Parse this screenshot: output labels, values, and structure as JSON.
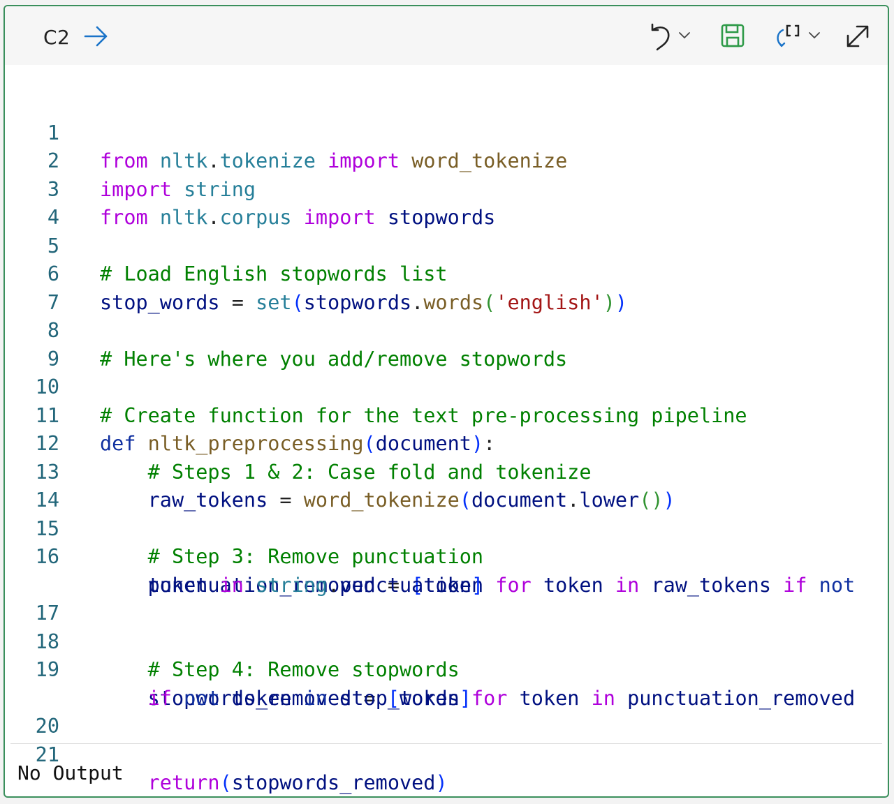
{
  "cell": {
    "id": "C2",
    "output_text": "No Output"
  },
  "toolbar": {
    "icons": [
      "run-arrow-icon",
      "undo-icon",
      "chevron-down-icon",
      "save-icon",
      "format-brackets-icon",
      "chevron-down-icon",
      "expand-icon"
    ]
  },
  "colors": {
    "border": "#3a8f5c",
    "keyword": "#af00db",
    "comment": "#008000",
    "string": "#a31515",
    "function": "#795e26",
    "module": "#267f99",
    "variable": "#001080",
    "line_number": "#22667a"
  },
  "code": {
    "line_numbers": [
      "1",
      "2",
      "3",
      "4",
      "5",
      "6",
      "7",
      "8",
      "9",
      "10",
      "11",
      "12",
      "13",
      "14",
      "15",
      "16",
      "17",
      "18",
      "19",
      "20",
      "21"
    ],
    "l1": {
      "a": "from",
      "b": "nltk",
      "c": ".",
      "d": "tokenize",
      "e": "import",
      "f": "word_tokenize"
    },
    "l2": {
      "a": "import",
      "b": "string"
    },
    "l3": {
      "a": "from",
      "b": "nltk",
      "c": ".",
      "d": "corpus",
      "e": "import",
      "f": "stopwords"
    },
    "l5": {
      "a": "# Load English stopwords list"
    },
    "l6": {
      "a": "stop_words",
      "b": " = ",
      "c": "set",
      "d": "(",
      "e": "stopwords",
      "f": ".",
      "g": "words",
      "h": "(",
      "i": "'english'",
      "j": ")",
      "k": ")"
    },
    "l8": {
      "a": "# Here's where you add/remove stopwords"
    },
    "l10": {
      "a": "# Create function for the text pre-processing pipeline"
    },
    "l11": {
      "a": "def",
      "b": "nltk_preprocessing",
      "c": "(",
      "d": "document",
      "e": ")",
      "f": ":"
    },
    "l12": {
      "a": "# Steps 1 & 2: Case fold and tokenize"
    },
    "l13": {
      "a": "raw_tokens",
      "b": " = ",
      "c": "word_tokenize",
      "d": "(",
      "e": "document",
      "f": ".",
      "g": "lower",
      "h": "()",
      "i": ")"
    },
    "l15": {
      "a": "# Step 3: Remove punctuation"
    },
    "l16": {
      "a": "punctuation_removed",
      "b": " = ",
      "c": "[",
      "d": "token",
      "e": "for",
      "f": "token",
      "g": "in",
      "h": "raw_tokens",
      "i": "if",
      "j": "not"
    },
    "l16b": {
      "a": "token",
      "b": "in",
      "c": "string",
      "d": ".",
      "e": "punctuation",
      "f": "]"
    },
    "l18": {
      "a": "# Step 4: Remove stopwords"
    },
    "l19": {
      "a": "stopwords_removed",
      "b": " = ",
      "c": "[",
      "d": "token",
      "e": "for",
      "f": "token",
      "g": "in",
      "h": "punctuation_removed"
    },
    "l19b": {
      "a": "if",
      "b": "not",
      "c": "token",
      "d": "in",
      "e": "stop_words",
      "f": "]"
    },
    "l21": {
      "a": "return",
      "b": "(",
      "c": "stopwords_removed",
      "d": ")"
    }
  }
}
